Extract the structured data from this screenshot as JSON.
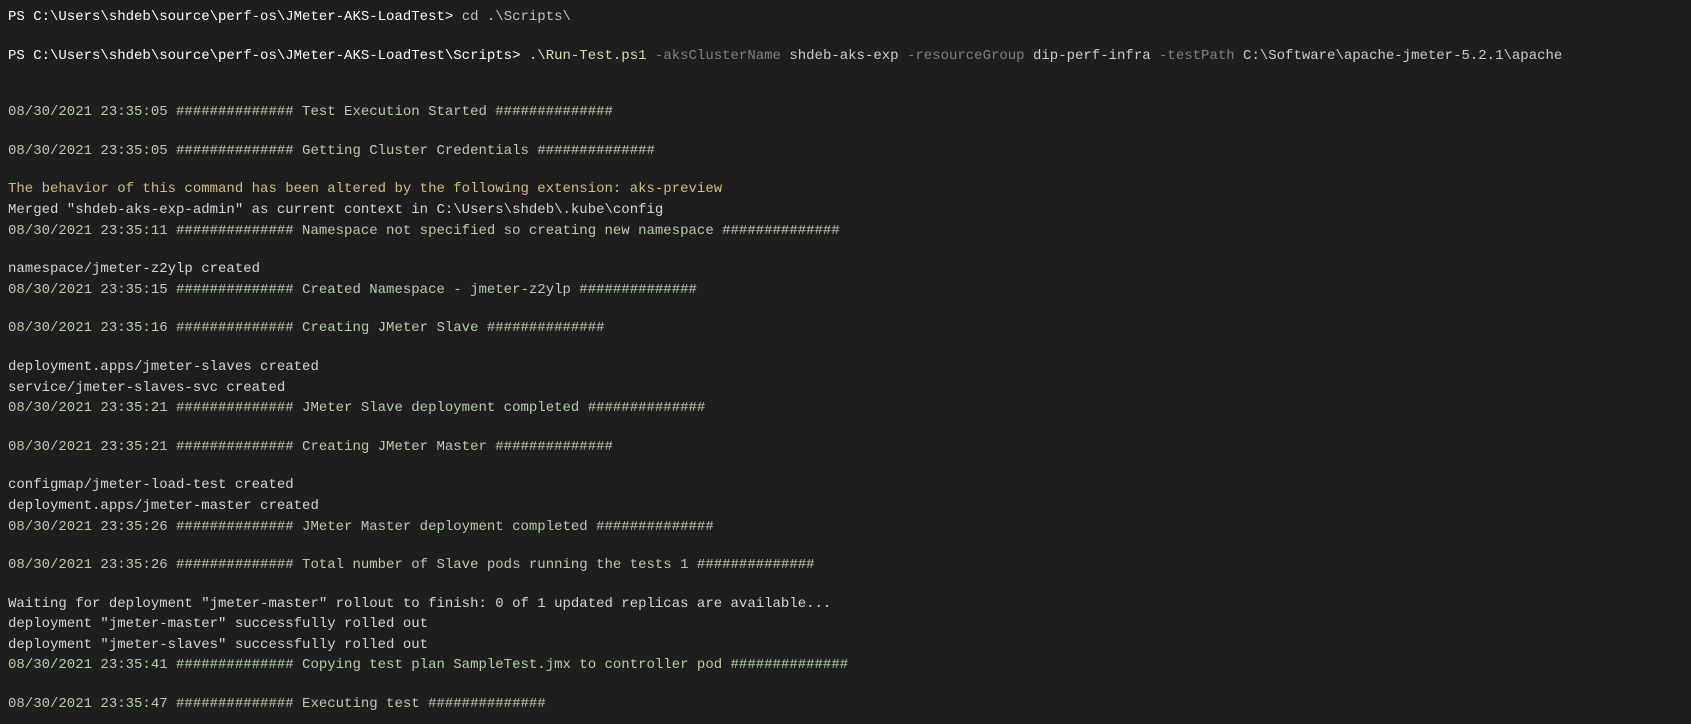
{
  "lines": [
    {
      "type": "prompt",
      "prompt": "PS C:\\Users\\shdeb\\source\\perf-os\\JMeter-AKS-LoadTest>",
      "command": "cd .\\Scripts\\"
    },
    {
      "type": "blank"
    },
    {
      "type": "prompt-run",
      "prompt": "PS C:\\Users\\shdeb\\source\\perf-os\\JMeter-AKS-LoadTest\\Scripts>",
      "script": ".\\Run-Test.ps1",
      "args": [
        {
          "flag": "-aksClusterName",
          "value": "shdeb-aks-exp"
        },
        {
          "flag": "-resourceGroup",
          "value": "dip-perf-infra"
        },
        {
          "flag": "-testPath",
          "value": "C:\\Software\\apache-jmeter-5.2.1\\apache"
        }
      ]
    },
    {
      "type": "blank"
    },
    {
      "type": "blank"
    },
    {
      "type": "timestamp",
      "text": "08/30/2021 23:35:05 ############## Test Execution Started ##############"
    },
    {
      "type": "blank"
    },
    {
      "type": "timestamp",
      "text": "08/30/2021 23:35:05 ############## Getting Cluster Credentials ##############"
    },
    {
      "type": "blank"
    },
    {
      "type": "warn",
      "text": "The behavior of this command has been altered by the following extension: aks-preview"
    },
    {
      "type": "white",
      "text": "Merged \"shdeb-aks-exp-admin\" as current context in C:\\Users\\shdeb\\.kube\\config"
    },
    {
      "type": "timestamp",
      "text": "08/30/2021 23:35:11 ############## Namespace not specified so creating new namespace ##############"
    },
    {
      "type": "blank"
    },
    {
      "type": "white",
      "text": "namespace/jmeter-z2ylp created"
    },
    {
      "type": "timestamp",
      "text": "08/30/2021 23:35:15 ############## Created Namespace - jmeter-z2ylp  ##############"
    },
    {
      "type": "blank"
    },
    {
      "type": "timestamp",
      "text": "08/30/2021 23:35:16 ############## Creating JMeter Slave ##############"
    },
    {
      "type": "blank"
    },
    {
      "type": "white",
      "text": "deployment.apps/jmeter-slaves created"
    },
    {
      "type": "white",
      "text": "service/jmeter-slaves-svc created"
    },
    {
      "type": "timestamp",
      "text": "08/30/2021 23:35:21 ############## JMeter Slave deployment completed ##############"
    },
    {
      "type": "blank"
    },
    {
      "type": "timestamp",
      "text": "08/30/2021 23:35:21 ############## Creating JMeter Master ##############"
    },
    {
      "type": "blank"
    },
    {
      "type": "white",
      "text": "configmap/jmeter-load-test created"
    },
    {
      "type": "white",
      "text": "deployment.apps/jmeter-master created"
    },
    {
      "type": "timestamp",
      "text": "08/30/2021 23:35:26 ############## JMeter Master deployment completed ##############"
    },
    {
      "type": "blank"
    },
    {
      "type": "timestamp",
      "text": "08/30/2021 23:35:26 ############## Total number of Slave pods running the tests 1  ##############"
    },
    {
      "type": "blank"
    },
    {
      "type": "white",
      "text": "Waiting for deployment \"jmeter-master\" rollout to finish: 0 of 1 updated replicas are available..."
    },
    {
      "type": "white",
      "text": "deployment \"jmeter-master\" successfully rolled out"
    },
    {
      "type": "white",
      "text": "deployment \"jmeter-slaves\" successfully rolled out"
    },
    {
      "type": "timestamp",
      "text": "08/30/2021 23:35:41 ############## Copying test plan SampleTest.jmx to controller pod ##############"
    },
    {
      "type": "blank"
    },
    {
      "type": "timestamp",
      "text": "08/30/2021 23:35:47 ############## Executing test ##############"
    }
  ]
}
